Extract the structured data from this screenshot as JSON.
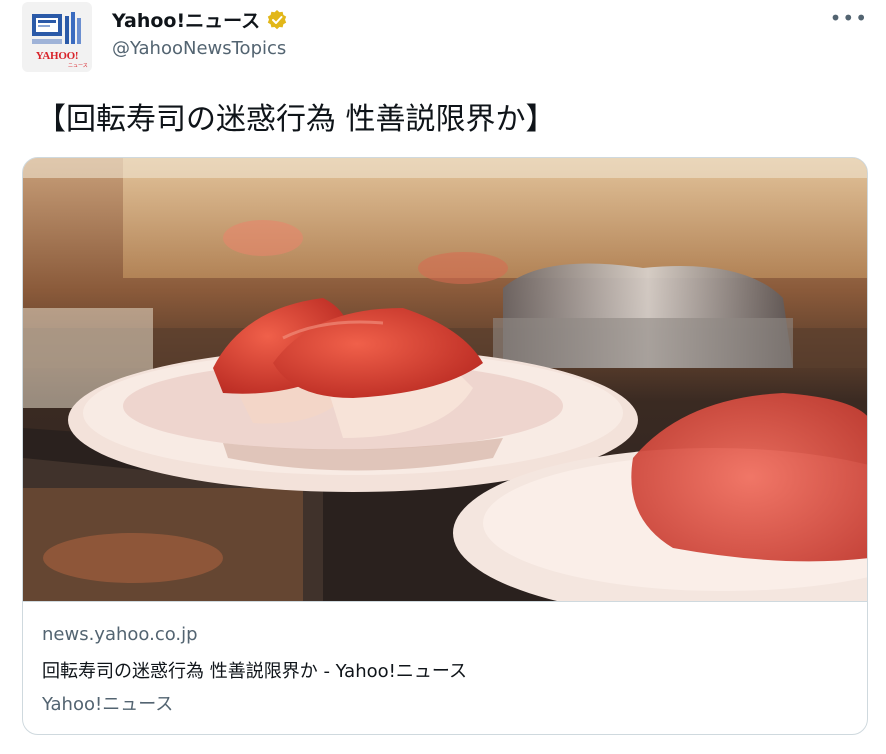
{
  "author": {
    "display_name": "Yahoo!ニュース",
    "handle": "@YahooNewsTopics",
    "avatar_logo_text": "YAHOO!",
    "avatar_logo_sub": "ニュース",
    "verified_icon": "verified-badge-icon"
  },
  "more_label": "•••",
  "tweet": {
    "text": "【回転寿司の迷惑行為 性善説限界か】"
  },
  "card": {
    "image_icon": "sushi-photo",
    "domain": "news.yahoo.co.jp",
    "title": "回転寿司の迷惑行為 性善説限界か - Yahoo!ニュース",
    "source": "Yahoo!ニュース"
  },
  "colors": {
    "text_primary": "#0f1419",
    "text_secondary": "#536471",
    "border": "#cfd9de",
    "verified_gold": "#e2b719",
    "yahoo_red": "#d8232a"
  }
}
